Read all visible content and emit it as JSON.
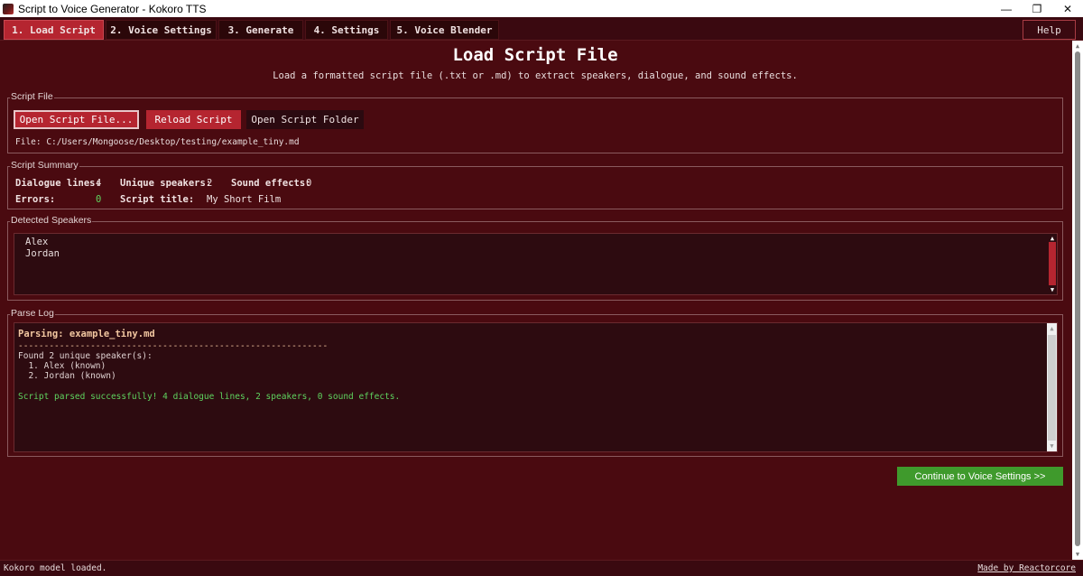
{
  "window": {
    "title": "Script to Voice Generator - Kokoro TTS",
    "minimize": "—",
    "restore": "❐",
    "close": "✕"
  },
  "tabs": [
    {
      "label": "1. Load Script"
    },
    {
      "label": "2. Voice Settings"
    },
    {
      "label": "3. Generate"
    },
    {
      "label": "4. Settings"
    },
    {
      "label": "5. Voice Blender"
    }
  ],
  "help_label": "Help",
  "header": {
    "title": "Load Script File",
    "description": "Load a formatted script file (.txt or .md) to extract speakers, dialogue, and sound effects."
  },
  "script_file": {
    "legend": "Script File",
    "open_label": "Open Script File...",
    "reload_label": "Reload Script",
    "folder_label": "Open Script Folder",
    "file_path": "File: C:/Users/Mongoose/Desktop/testing/example_tiny.md"
  },
  "summary": {
    "legend": "Script Summary",
    "dialogue_label": "Dialogue lines:",
    "dialogue_value": "4",
    "speakers_label": "Unique speakers:",
    "speakers_value": "2",
    "sfx_label": "Sound effects:",
    "sfx_value": "0",
    "errors_label": "Errors:",
    "errors_value": "0",
    "title_label": "Script title:",
    "title_value": "My Short Film"
  },
  "speakers": {
    "legend": "Detected Speakers",
    "items": [
      "Alex",
      "Jordan"
    ]
  },
  "log": {
    "legend": "Parse Log",
    "heading": "Parsing: example_tiny.md",
    "separator": "------------------------------------------------------------",
    "found": "Found 2 unique speaker(s):",
    "speaker1": "  1. Alex (known)",
    "speaker2": "  2. Jordan (known)",
    "success": "Script parsed successfully! 4 dialogue lines, 2 speakers, 0 sound effects."
  },
  "continue_label": "Continue to Voice Settings  >>",
  "status": {
    "text": "Kokoro model loaded.",
    "made_by": "Made by Reactorcore"
  },
  "colors": {
    "background": "#4a0a10",
    "accent": "#b52530",
    "success": "#3f9a2c"
  }
}
